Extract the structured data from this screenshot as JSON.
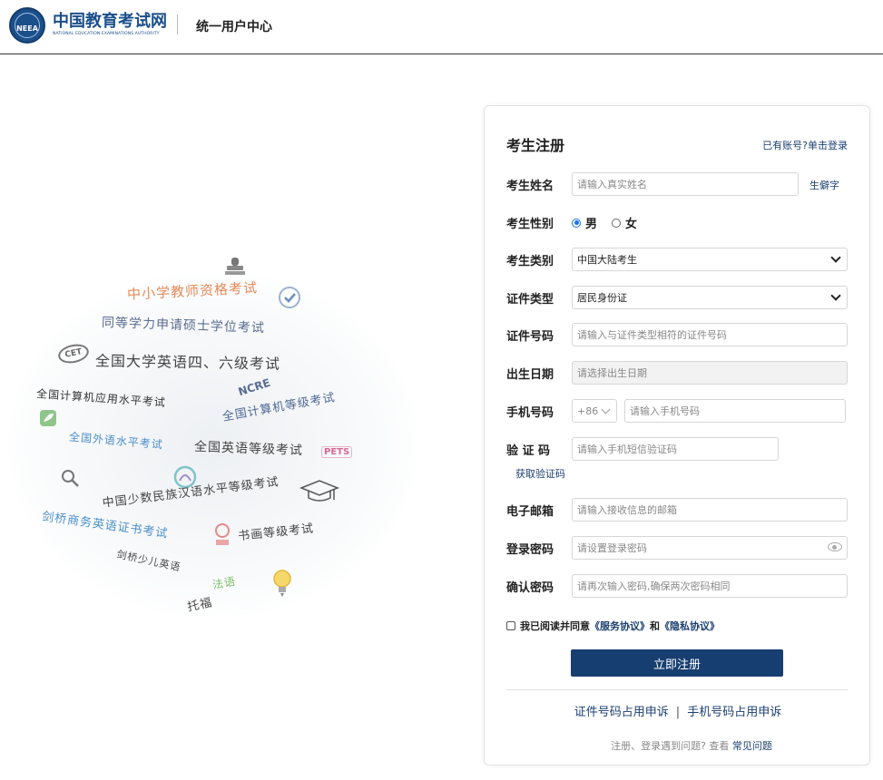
{
  "header": {
    "logo_cn": "中国教育考试网",
    "logo_en": "NATIONAL EDUCATION EXAMINATIONS AUTHORITY",
    "logo_badge": "NEEA",
    "title": "统一用户中心"
  },
  "illustration": {
    "words": [
      "中小学教师资格考试",
      "同等学力申请硕士学位考试",
      "全国大学英语四、六级考试",
      "全国计算机应用水平考试",
      "全国计算机等级考试",
      "全国外语水平考试",
      "全国英语等级考试",
      "中国少数民族汉语水平等级考试",
      "剑桥商务英语证书考试",
      "书画等级考试",
      "剑桥少儿英语",
      "法语",
      "托福"
    ],
    "badges": {
      "cet": "CET",
      "ncre": "NCRE",
      "pets": "PETS"
    }
  },
  "form": {
    "title": "考生注册",
    "login_link": "已有账号?单击登录",
    "name": {
      "label": "考生姓名",
      "placeholder": "请输入真实姓名",
      "rare_char_link": "生僻字"
    },
    "gender": {
      "label": "考生性别",
      "options": [
        "男",
        "女"
      ],
      "selected": "男"
    },
    "category": {
      "label": "考生类别",
      "value": "中国大陆考生"
    },
    "id_type": {
      "label": "证件类型",
      "value": "居民身份证"
    },
    "id_number": {
      "label": "证件号码",
      "placeholder": "请输入与证件类型相符的证件号码"
    },
    "birth_date": {
      "label": "出生日期",
      "placeholder": "请选择出生日期"
    },
    "phone": {
      "label": "手机号码",
      "country_code": "+86",
      "placeholder": "请输入手机号码"
    },
    "code": {
      "label": "验 证 码",
      "placeholder": "请输入手机短信验证码",
      "get_code": "获取验证码"
    },
    "email": {
      "label": "电子邮箱",
      "placeholder": "请输入接收信息的邮箱"
    },
    "password": {
      "label": "登录密码",
      "placeholder": "请设置登录密码"
    },
    "confirm": {
      "label": "确认密码",
      "placeholder": "请再次输入密码,确保两次密码相同"
    },
    "agree": {
      "prefix": "我已阅读并同意",
      "service": "《服务协议》",
      "and": "和",
      "privacy": "《隐私协议》"
    },
    "submit": "立即注册",
    "appeal_id": "证件号码占用申诉",
    "appeal_sep": "|",
    "appeal_phone": "手机号码占用申诉",
    "faq_prefix": "注册、登录遇到问题? 查看",
    "faq_link": "常见问题"
  }
}
